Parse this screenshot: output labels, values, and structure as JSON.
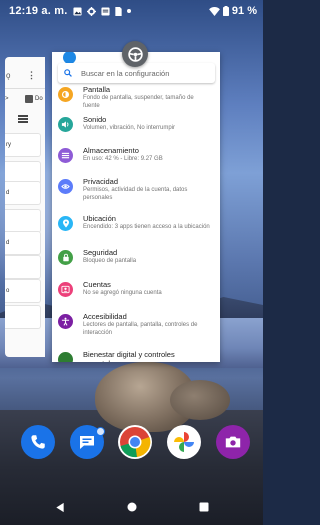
{
  "status_bar": {
    "time": "12:19 a. m.",
    "battery": "91 %",
    "icons": [
      "gallery-icon",
      "settings-icon",
      "message-icon",
      "sim-icon",
      "dot"
    ]
  },
  "left_card": {
    "rows": [
      {
        "label": "ry"
      },
      {
        "label": "d"
      },
      {
        "label": "d"
      },
      {
        "label": "o"
      }
    ]
  },
  "settings": {
    "search_placeholder": "Buscar en la configuración",
    "items": [
      {
        "title": "Pantalla",
        "subtitle": "Fondo de pantalla, suspender, tamaño de fuente",
        "icon": "brightness-icon",
        "color": "#f5a623"
      },
      {
        "title": "Sonido",
        "subtitle": "Volumen, vibración, No interrumpir",
        "icon": "volume-icon",
        "color": "#26a69a"
      },
      {
        "title": "Almacenamiento",
        "subtitle": "En uso: 42 % - Libre: 9.27 GB",
        "icon": "storage-icon",
        "color": "#8e5bd6"
      },
      {
        "title": "Privacidad",
        "subtitle": "Permisos, actividad de la cuenta, datos personales",
        "icon": "privacy-icon",
        "color": "#5c7cfa"
      },
      {
        "title": "Ubicación",
        "subtitle": "Encendido: 3 apps tienen acceso a la ubicación",
        "icon": "location-icon",
        "color": "#29b6f6"
      },
      {
        "title": "Seguridad",
        "subtitle": "Bloqueo de pantalla",
        "icon": "lock-icon",
        "color": "#43a047"
      },
      {
        "title": "Cuentas",
        "subtitle": "No se agregó ninguna cuenta",
        "icon": "account-icon",
        "color": "#ec407a"
      },
      {
        "title": "Accesibilidad",
        "subtitle": "Lectores de pantalla, pantalla, controles de interacción",
        "icon": "accessibility-icon",
        "color": "#7b1fa2"
      },
      {
        "title": "Bienestar digital y controles parentales",
        "subtitle": "",
        "icon": "wellbeing-icon",
        "color": "#2e7d32"
      }
    ]
  },
  "dock": {
    "apps": [
      {
        "name": "phone",
        "color": "#1a73e8"
      },
      {
        "name": "messages",
        "color": "#1a73e8"
      },
      {
        "name": "chrome",
        "color": "#ffffff"
      },
      {
        "name": "photos",
        "color": "#ffffff"
      },
      {
        "name": "camera",
        "color": "#8e24aa"
      }
    ]
  }
}
